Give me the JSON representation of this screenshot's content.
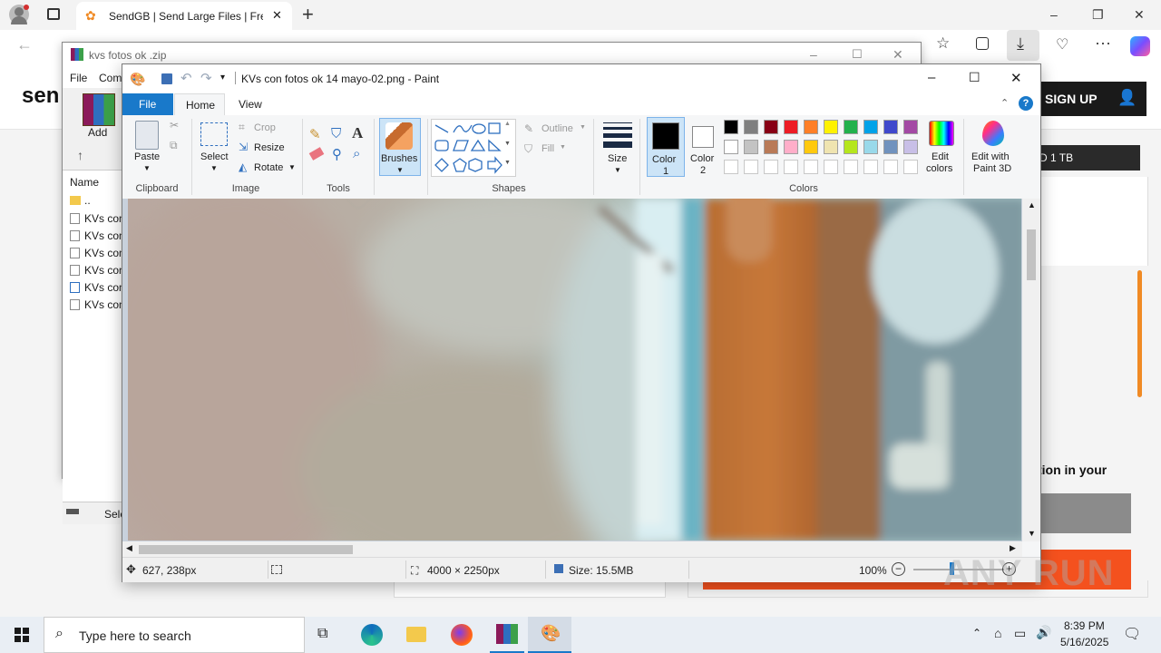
{
  "edge": {
    "tab_title": "SendGB | Send Large Files | Free fi",
    "new_tab": "+",
    "window_controls": {
      "minimize": "–",
      "restore": "❐",
      "close": "✕"
    }
  },
  "sendgb": {
    "logo": "sen",
    "signup": "SIGN UP",
    "storage_badge": "D 1 TB",
    "text_fragment": "tion in your"
  },
  "winrar": {
    "title": "kvs fotos ok .zip",
    "menu": [
      "File",
      "Com"
    ],
    "add_label": "Add",
    "column_name": "Name",
    "parent_dir": "..",
    "files": [
      "KVs con",
      "KVs con",
      "KVs con",
      "KVs con",
      "KVs con",
      "KVs con"
    ],
    "status_fragment": "Sele"
  },
  "paint": {
    "title": "KVs con fotos ok 14 mayo-02.png - Paint",
    "tabs": {
      "file": "File",
      "home": "Home",
      "view": "View"
    },
    "clipboard": {
      "paste": "Paste",
      "label": "Clipboard"
    },
    "image": {
      "select": "Select",
      "crop": "Crop",
      "resize": "Resize",
      "rotate": "Rotate",
      "label": "Image"
    },
    "tools": {
      "label": "Tools"
    },
    "brushes": "Brushes",
    "shapes": {
      "outline": "Outline",
      "fill": "Fill",
      "label": "Shapes"
    },
    "size": "Size",
    "color1": {
      "line1": "Color",
      "line2": "1"
    },
    "color2": {
      "line1": "Color",
      "line2": "2"
    },
    "colors_label": "Colors",
    "edit_colors": {
      "line1": "Edit",
      "line2": "colors"
    },
    "paint3d": {
      "line1": "Edit with",
      "line2": "Paint 3D"
    },
    "palette_row1": [
      "#000000",
      "#7f7f7f",
      "#880015",
      "#ed1c24",
      "#ff7f27",
      "#fff200",
      "#22b14c",
      "#00a2e8",
      "#3f48cc",
      "#a349a4"
    ],
    "palette_row2": [
      "#ffffff",
      "#c3c3c3",
      "#b97a57",
      "#ffaec9",
      "#ffc90e",
      "#efe4b0",
      "#b5e61d",
      "#99d9ea",
      "#7092be",
      "#c8bfe7"
    ],
    "status": {
      "cursor_pos": "627, 238px",
      "image_dims": "4000 × 2250px",
      "file_size": "Size: 15.5MB",
      "zoom": "100%"
    }
  },
  "taskbar": {
    "search_placeholder": "Type here to search",
    "time": "8:39 PM",
    "date": "5/16/2025"
  },
  "watermark": "ANY RUN"
}
